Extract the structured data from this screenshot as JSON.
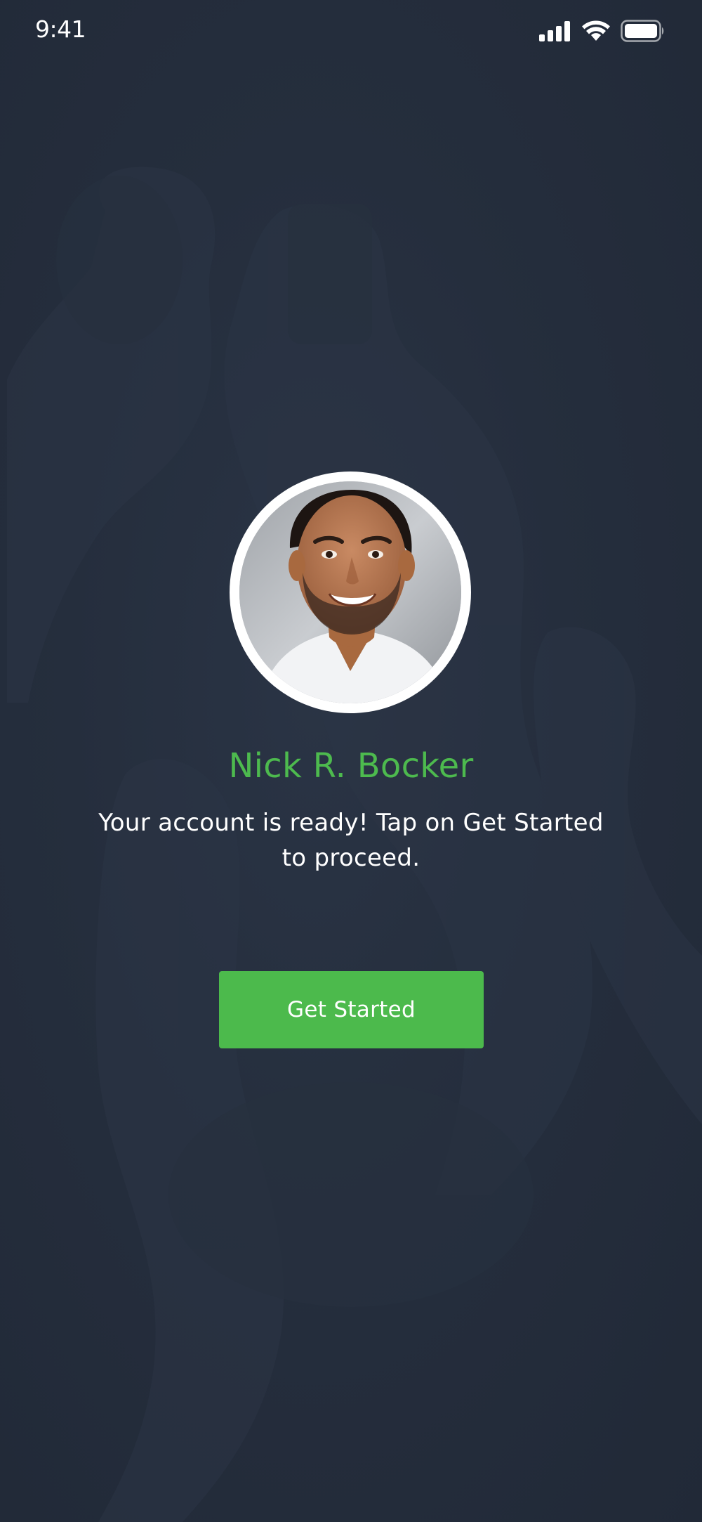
{
  "status_bar": {
    "time": "9:41",
    "icons": [
      "signal-icon",
      "wifi-icon",
      "battery-icon"
    ]
  },
  "profile": {
    "name": "Nick R. Bocker",
    "avatar_icon": "user-photo"
  },
  "message": "Your account is ready! Tap on Get Started to proceed.",
  "cta": {
    "label": "Get Started"
  },
  "colors": {
    "background": "#232c3b",
    "accent": "#4cba4c",
    "text": "#ffffff"
  }
}
